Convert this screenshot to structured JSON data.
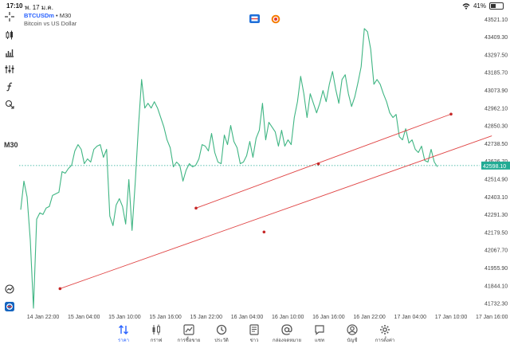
{
  "status_bar": {
    "time": "17:10",
    "date": "พ. 17 ม.ค.",
    "battery": "41%",
    "battery_level": 0.41
  },
  "symbol": {
    "name": "BTCUSDm",
    "separator": " • ",
    "timeframe": "M30",
    "description": "Bitcoin vs US Dollar"
  },
  "toolbar": {
    "timeframe_label": "M30"
  },
  "price_badge": {
    "value": "42598.10",
    "color": "#22ab94"
  },
  "colors": {
    "series": "#3fb583",
    "trendlines": "#e04545",
    "anchor_points": "#c62828",
    "current_price_line": "#22ab94",
    "active_tab": "#2962ff"
  },
  "chart_data": {
    "type": "line",
    "title": "",
    "y_ticks": [
      "43521.10",
      "43409.30",
      "43297.50",
      "43185.70",
      "43073.90",
      "42962.10",
      "42850.30",
      "42738.50",
      "42626.70",
      "42514.90",
      "42403.10",
      "42291.30",
      "42179.50",
      "42067.70",
      "41955.90",
      "41844.10",
      "41732.30"
    ],
    "x_ticks": [
      "14 Jan 22:00",
      "15 Jan 04:00",
      "15 Jan 10:00",
      "15 Jan 16:00",
      "15 Jan 22:00",
      "16 Jan 04:00",
      "16 Jan 10:00",
      "16 Jan 16:00",
      "16 Jan 22:00",
      "17 Jan 04:00",
      "17 Jan 10:00",
      "17 Jan 16:00"
    ],
    "ylim": [
      41690,
      43570
    ],
    "current_price": 42598.1,
    "series": [
      {
        "values": [
          42320,
          42500,
          42400,
          42130,
          41700,
          42260,
          42300,
          42290,
          42330,
          42340,
          42410,
          42420,
          42430,
          42560,
          42550,
          42580,
          42600,
          42690,
          42730,
          42700,
          42610,
          42640,
          42620,
          42700,
          42720,
          42730,
          42650,
          42700,
          42280,
          42220,
          42350,
          42390,
          42340,
          42230,
          42510,
          42190,
          42490,
          42840,
          43140,
          42960,
          42990,
          42960,
          43000,
          42960,
          42900,
          42840,
          42760,
          42710,
          42590,
          42620,
          42600,
          42500,
          42570,
          42610,
          42590,
          42600,
          42640,
          42730,
          42720,
          42690,
          42800,
          42680,
          42620,
          42610,
          42790,
          42730,
          42850,
          42750,
          42710,
          42610,
          42620,
          42660,
          42750,
          42650,
          42770,
          42820,
          42990,
          42760,
          42870,
          42840,
          42810,
          42720,
          42820,
          42720,
          42760,
          42730,
          42900,
          43000,
          43160,
          43050,
          42900,
          43050,
          42990,
          42930,
          42990,
          43070,
          43000,
          43110,
          43190,
          43080,
          42990,
          43140,
          43170,
          43050,
          42970,
          43030,
          43120,
          43220,
          43460,
          43440,
          43330,
          43110,
          43140,
          43110,
          43050,
          43000,
          42930,
          42900,
          42920,
          42780,
          42760,
          42830,
          42740,
          42760,
          42700,
          42680,
          42720,
          42630,
          42620,
          42700,
          42620,
          42590
        ]
      }
    ],
    "trendlines": [
      {
        "x": [
          "15 Jan 20:30",
          "16 Jan 14:30",
          "17 Jan 10:00"
        ],
        "y": [
          42330,
          42609,
          42922
        ]
      },
      {
        "x": [
          "15 Jan 00:30",
          "16 Jan 06:30",
          "17 Jan 16:00"
        ],
        "y": [
          41823,
          42180,
          42785
        ]
      }
    ]
  },
  "tabs": [
    {
      "label": "ราคา",
      "icon": "sort-arrows-icon",
      "active": true
    },
    {
      "label": "กราฟ",
      "icon": "candlestick-icon"
    },
    {
      "label": "การซื้อขาย",
      "icon": "trade-chart-icon"
    },
    {
      "label": "ประวัติ",
      "icon": "history-icon"
    },
    {
      "label": "ข่าว",
      "icon": "news-icon"
    },
    {
      "label": "กล่องจดหมาย",
      "icon": "mailbox-icon"
    },
    {
      "label": "แชท",
      "icon": "chat-icon"
    },
    {
      "label": "บัญชี",
      "icon": "account-icon"
    },
    {
      "label": "การตั้งค่า",
      "icon": "settings-icon"
    }
  ]
}
